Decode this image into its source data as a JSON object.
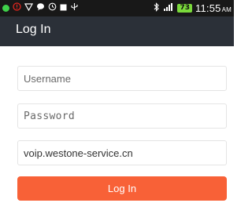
{
  "status_bar": {
    "time": "11:55",
    "ampm": "AM",
    "battery": "73",
    "icons_left": [
      "green-dot-icon",
      "alert-icon",
      "shield-icon",
      "chat-bubble-icon",
      "sync-icon",
      "stop-icon",
      "usb-icon"
    ],
    "icons_right": [
      "bluetooth-icon",
      "signal-icon",
      "battery-icon"
    ]
  },
  "app_bar": {
    "title": "Log In"
  },
  "form": {
    "username_placeholder": "Username",
    "password_placeholder": "Password",
    "server_value": "voip.westone-service.cn",
    "login_label": "Log In"
  },
  "colors": {
    "status_bar_bg": "#181818",
    "app_bar_bg": "#2b3038",
    "button_bg": "#f86137",
    "field_border": "#e4e4e4"
  }
}
